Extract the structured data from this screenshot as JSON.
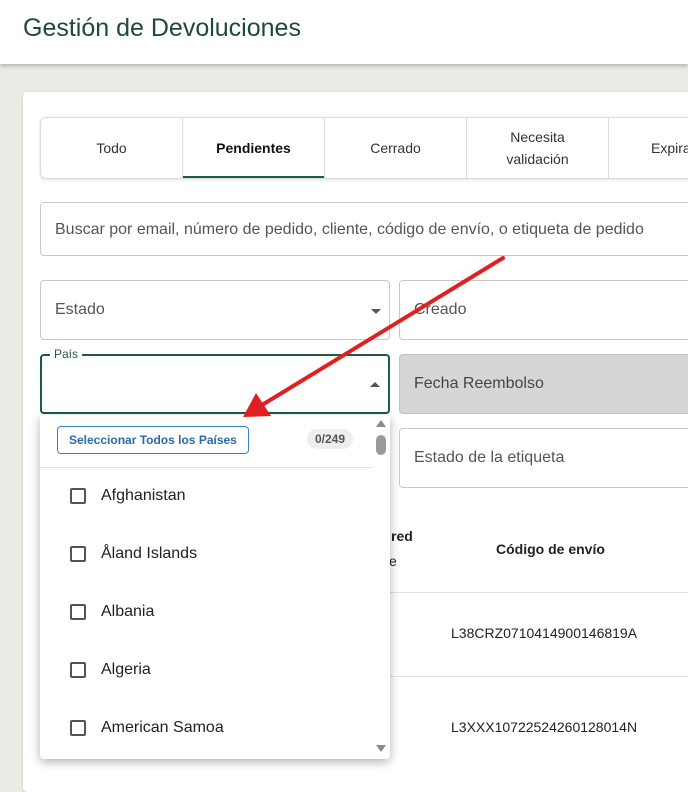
{
  "header": {
    "title": "Gestión de Devoluciones"
  },
  "tabs": [
    {
      "label": "Todo",
      "active": false
    },
    {
      "label": "Pendientes",
      "active": true
    },
    {
      "label": "Cerrado",
      "active": false
    },
    {
      "label": "Necesita validación",
      "active": false
    },
    {
      "label": "Expira",
      "active": false
    }
  ],
  "filters": {
    "search_placeholder": "Buscar por email, número de pedido, cliente, código de envío, o etiqueta de pedido",
    "estado": "Estado",
    "creado": "Creado",
    "pais_label": "País",
    "fecha_reembolso": "Fecha Reembolso",
    "estado_etiqueta": "Estado de la etiqueta"
  },
  "dropdown": {
    "select_all_label": "Seleccionar Todos los Países",
    "count": "0/249",
    "options": [
      "Afghanistan",
      "Åland Islands",
      "Albania",
      "Algeria",
      "American Samoa"
    ]
  },
  "table": {
    "partial_header_line1": "red",
    "partial_header_line2": "e",
    "shipping_code_header": "Código de envío",
    "rows": [
      {
        "shipping_code": "L38CRZ0710414900146819A"
      },
      {
        "shipping_code": "L3XXX10722524260128014N"
      }
    ]
  },
  "colors": {
    "brand_green": "#1f5b40",
    "annotation_arrow": "#e02020",
    "select_all_blue": "#2c6aa8"
  }
}
